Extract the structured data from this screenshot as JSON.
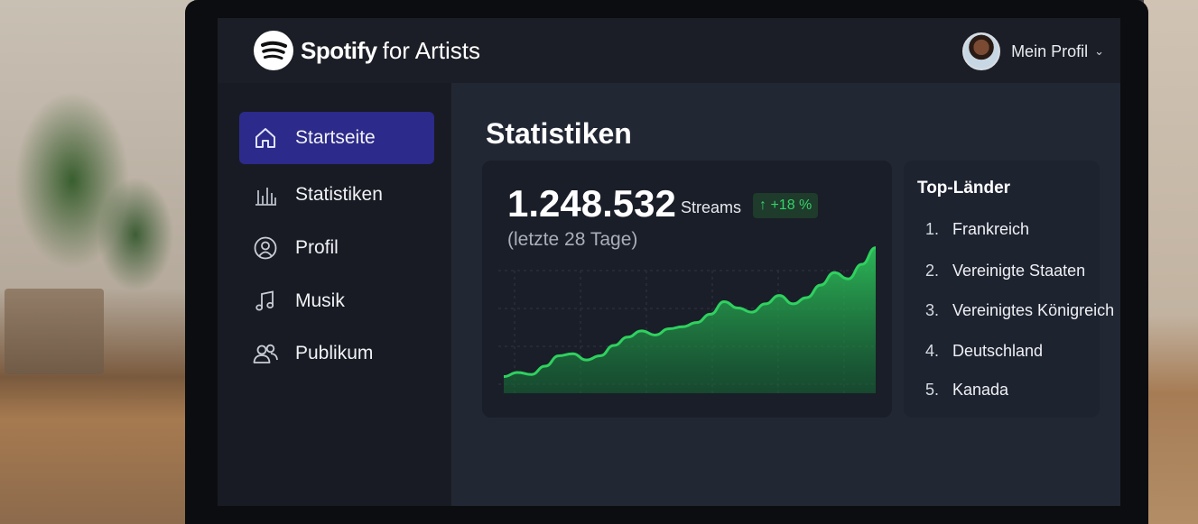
{
  "brand": {
    "name_bold": "Spotify",
    "name_light": "for Artists"
  },
  "profile": {
    "label": "Mein Profil"
  },
  "sidebar": {
    "items": [
      {
        "label": "Startseite",
        "icon": "home-icon",
        "active": true
      },
      {
        "label": "Statistiken",
        "icon": "bar-chart-icon",
        "active": false
      },
      {
        "label": "Profil",
        "icon": "user-circle-icon",
        "active": false
      },
      {
        "label": "Musik",
        "icon": "music-note-icon",
        "active": false
      },
      {
        "label": "Publikum",
        "icon": "users-icon",
        "active": false
      }
    ]
  },
  "main": {
    "title": "Statistiken",
    "streams": {
      "value": "1.248.532",
      "unit": "Streams",
      "change": "↑ +18 %",
      "period": "(letzte 28 Tage)"
    },
    "top_countries": {
      "title": "Top-Länder",
      "items": [
        {
          "rank": "1.",
          "name": "Frankreich"
        },
        {
          "rank": "2.",
          "name": "Vereinigte Staaten"
        },
        {
          "rank": "3.",
          "name": "Vereinigtes Königreich"
        },
        {
          "rank": "4.",
          "name": "Deutschland"
        },
        {
          "rank": "5.",
          "name": "Kanada"
        }
      ]
    }
  },
  "colors": {
    "accent_active": "#2c2a8a",
    "chart_green": "#2fd15f",
    "badge_green": "#36d06a"
  },
  "chart_data": {
    "type": "area",
    "title": "",
    "xlabel": "",
    "ylabel": "",
    "x": [
      1,
      2,
      3,
      4,
      5,
      6,
      7,
      8,
      9,
      10,
      11,
      12,
      13,
      14,
      15,
      16,
      17,
      18,
      19,
      20,
      21,
      22,
      23,
      24,
      25,
      26,
      27,
      28
    ],
    "series": [
      {
        "values": [
          8,
          10,
          9,
          13,
          18,
          19,
          16,
          18,
          23,
          27,
          30,
          28,
          31,
          32,
          34,
          38,
          44,
          41,
          39,
          43,
          47,
          43,
          46,
          52,
          58,
          55,
          62,
          70
        ]
      }
    ],
    "ylim": [
      0,
      72
    ],
    "grid": true,
    "legend": "none"
  }
}
